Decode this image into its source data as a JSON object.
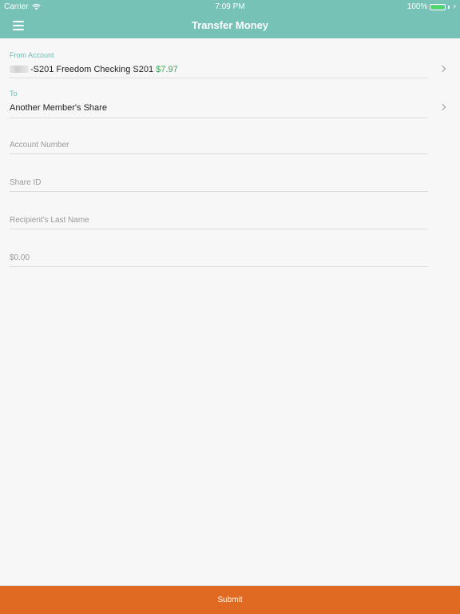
{
  "status_bar": {
    "carrier": "Carrier",
    "time": "7:09 PM",
    "battery": "100%"
  },
  "nav": {
    "title": "Transfer Money"
  },
  "form": {
    "from_account": {
      "label": "From Account",
      "value": "-S201 Freedom Checking S201",
      "balance": "$7.97"
    },
    "to": {
      "label": "To",
      "value": "Another Member's Share"
    },
    "account_number": {
      "placeholder": "Account Number"
    },
    "share_id": {
      "placeholder": "Share ID"
    },
    "recipient_last_name": {
      "placeholder": "Recipient's Last Name"
    },
    "amount": {
      "placeholder": "$0.00"
    }
  },
  "submit_label": "Submit",
  "colors": {
    "header": "#77c2b7",
    "accent": "#6fbcb0",
    "balance": "#3da55a",
    "submit": "#e06a22"
  }
}
